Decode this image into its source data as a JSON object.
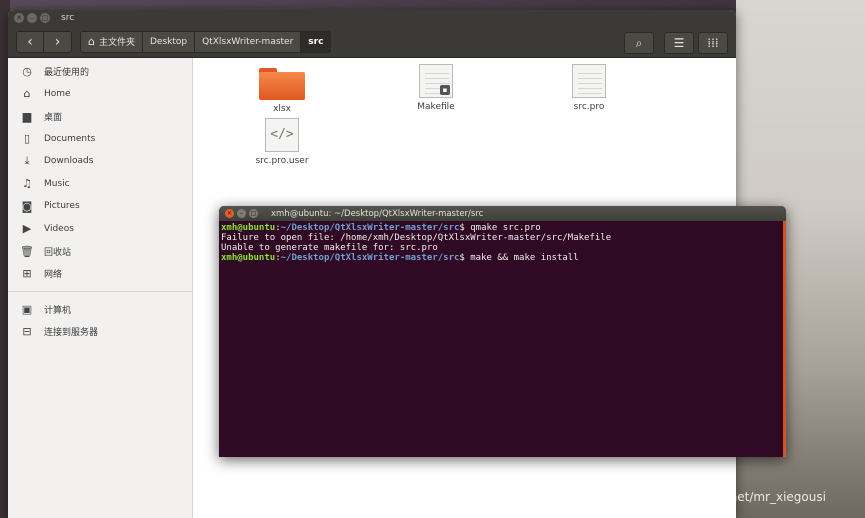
{
  "nautilus": {
    "title": "src",
    "breadcrumbs": [
      "主文件夹",
      "Desktop",
      "QtXlsxWriter-master",
      "src"
    ],
    "sidebar_items": [
      {
        "label": "最近使用的",
        "icon": "recent-icon"
      },
      {
        "label": "Home",
        "icon": "home-icon"
      },
      {
        "label": "桌面",
        "icon": "desktop-folder-icon"
      },
      {
        "label": "Documents",
        "icon": "documents-icon"
      },
      {
        "label": "Downloads",
        "icon": "downloads-icon"
      },
      {
        "label": "Music",
        "icon": "music-icon"
      },
      {
        "label": "Pictures",
        "icon": "pictures-icon"
      },
      {
        "label": "Videos",
        "icon": "videos-icon"
      },
      {
        "label": "回收站",
        "icon": "trash-icon"
      },
      {
        "label": "网络",
        "icon": "network-icon"
      }
    ],
    "sidebar_devices": [
      {
        "label": "计算机",
        "icon": "computer-icon"
      },
      {
        "label": "连接到服务器",
        "icon": "connect-server-icon"
      }
    ],
    "files": [
      {
        "name": "xlsx",
        "type": "folder"
      },
      {
        "name": "Makefile",
        "type": "locked-doc"
      },
      {
        "name": "src.pro",
        "type": "doc"
      },
      {
        "name": "src.pro.user",
        "type": "code"
      }
    ]
  },
  "terminal": {
    "title": "xmh@ubuntu: ~/Desktop/QtXlsxWriter-master/src",
    "lines": [
      {
        "user": "xmh@ubuntu",
        "path": "~/Desktop/QtXlsxWriter-master/src",
        "cmd": " qmake src.pro"
      },
      {
        "text": "Failure to open file: /home/xmh/Desktop/QtXlsxWriter-master/src/Makefile"
      },
      {
        "text": "Unable to generate makefile for: src.pro"
      },
      {
        "user": "xmh@ubuntu",
        "path": "~/Desktop/QtXlsxWriter-master/src",
        "cmd": " make && make install"
      }
    ]
  },
  "watermark": "https://blog.csdn.net/mr_xiegousi",
  "colors": {
    "terminal_bg": "#300a24",
    "prompt_user": "#8ae234",
    "prompt_path": "#729fcf",
    "folder": "#e0581f"
  }
}
